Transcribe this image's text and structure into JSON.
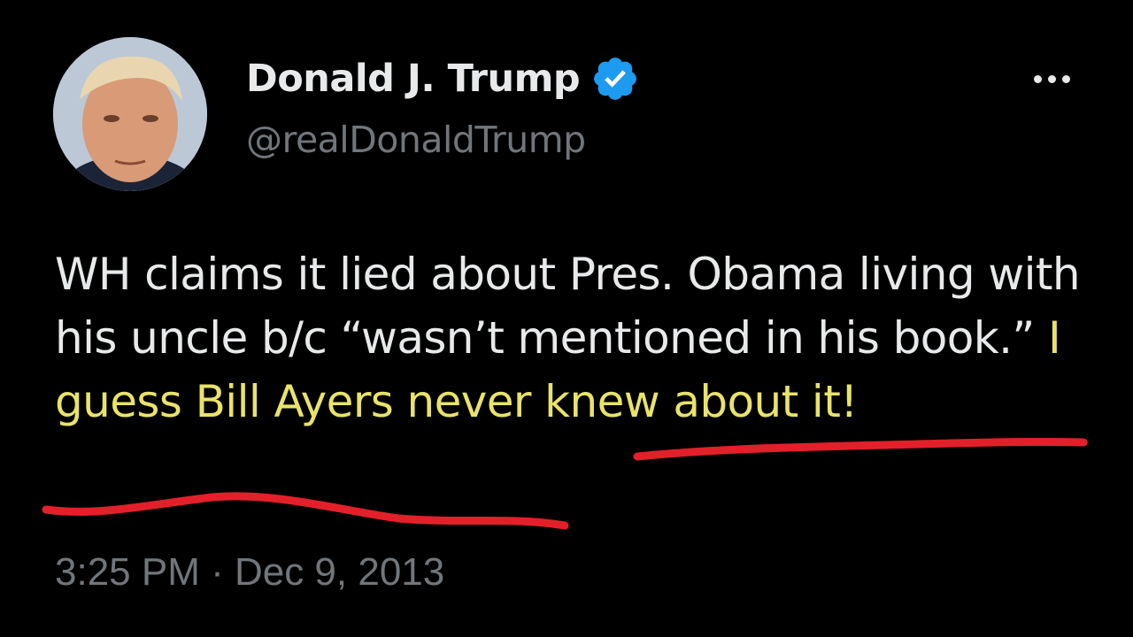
{
  "tweet": {
    "author": {
      "display_name": "Donald J. Trump",
      "handle": "@realDonaldTrump",
      "verified": true,
      "avatar_icon": "profile-photo"
    },
    "more_icon": "more-horizontal-icon",
    "text_plain": "WH claims it lied about Pres. Obama living with his uncle b/c “wasn’t mentioned in his book.” ",
    "text_highlighted": "I guess Bill Ayers never knew about it!",
    "timestamp": "3:25 PM · Dec 9, 2013"
  },
  "colors": {
    "background": "#000000",
    "text": "#e7e9ea",
    "muted": "#71767b",
    "verified_blue": "#1d9bf0",
    "highlight": "#e8e36a",
    "underline_red": "#e3202a"
  }
}
